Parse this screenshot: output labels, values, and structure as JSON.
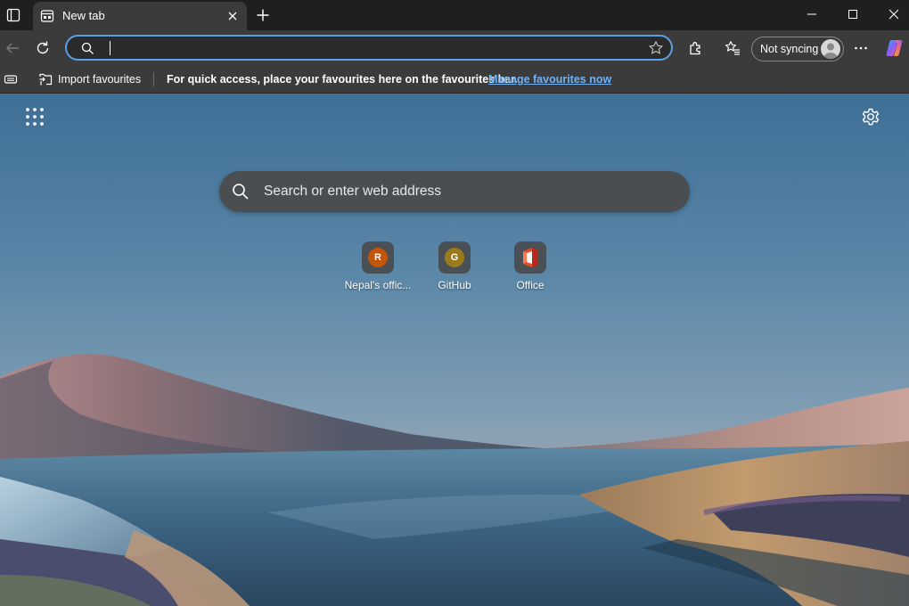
{
  "colors": {
    "accent": "#5a9ee8",
    "link": "#6fb2f7",
    "tile_r": "#c4540a",
    "tile_g": "#9b7a1c"
  },
  "tabs": [
    {
      "title": "New tab",
      "icon": "new-tab-page-icon",
      "active": true
    }
  ],
  "address_bar": {
    "value": "",
    "placeholder": ""
  },
  "toolbar": {
    "profile_label": "Not syncing"
  },
  "favourites_bar": {
    "import_label": "Import favourites",
    "message": "For quick access, place your favourites here on the favourites bar.",
    "link": "Manage favourites now"
  },
  "new_tab_page": {
    "search_placeholder": "Search or enter web address",
    "quick_links": [
      {
        "letter": "R",
        "label": "Nepal's offic...",
        "icon": "letter-avatar"
      },
      {
        "letter": "G",
        "label": "GitHub",
        "icon": "letter-avatar"
      },
      {
        "letter": "",
        "label": "Office",
        "icon": "office-logo-icon"
      }
    ]
  }
}
